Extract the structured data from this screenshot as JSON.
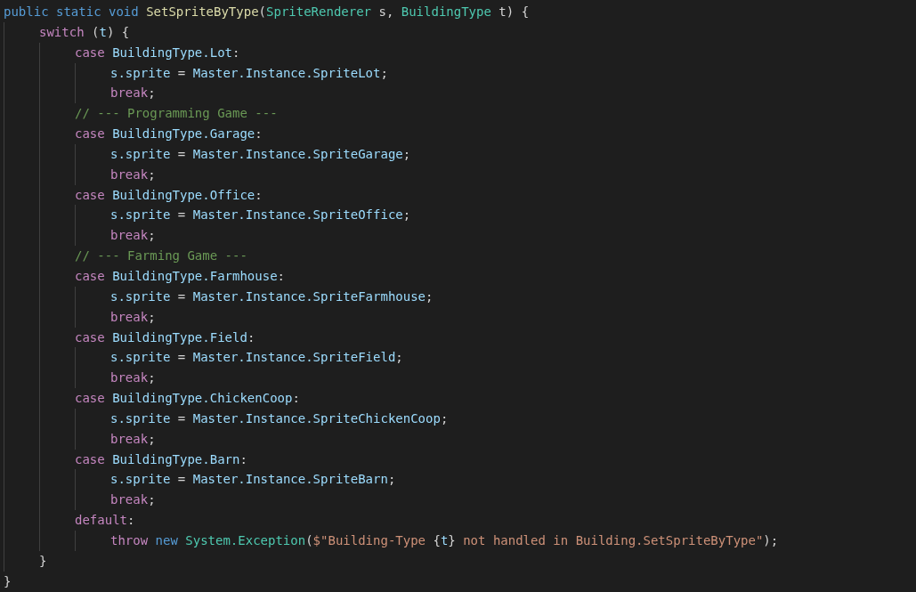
{
  "code_lines": [
    {
      "tokens": [
        {
          "kind": "kw",
          "text": "public static void "
        },
        {
          "kind": "fn",
          "text": "SetSpriteByType"
        },
        {
          "kind": "p",
          "text": "("
        },
        {
          "kind": "ty",
          "text": "SpriteRenderer"
        },
        {
          "kind": "p",
          "text": " s, "
        },
        {
          "kind": "ty",
          "text": "BuildingType"
        },
        {
          "kind": "p",
          "text": " t) {"
        }
      ],
      "children": [
        {
          "tokens": [
            {
              "kind": "ctl",
              "text": "switch"
            },
            {
              "kind": "p",
              "text": " ("
            },
            {
              "kind": "var",
              "text": "t"
            },
            {
              "kind": "p",
              "text": ") {"
            }
          ],
          "children": [
            {
              "tokens": [
                {
                  "kind": "ctl",
                  "text": "case "
                },
                {
                  "kind": "var",
                  "text": "BuildingType.Lot"
                },
                {
                  "kind": "p",
                  "text": ":"
                }
              ],
              "children": [
                {
                  "tokens": [
                    {
                      "kind": "var",
                      "text": "s.sprite"
                    },
                    {
                      "kind": "p",
                      "text": " = "
                    },
                    {
                      "kind": "var",
                      "text": "Master.Instance.SpriteLot"
                    },
                    {
                      "kind": "p",
                      "text": ";"
                    }
                  ]
                },
                {
                  "tokens": [
                    {
                      "kind": "ctl",
                      "text": "break"
                    },
                    {
                      "kind": "p",
                      "text": ";"
                    }
                  ]
                }
              ]
            },
            {
              "tokens": [
                {
                  "kind": "cm",
                  "text": "// --- Programming Game ---"
                }
              ]
            },
            {
              "tokens": [
                {
                  "kind": "ctl",
                  "text": "case "
                },
                {
                  "kind": "var",
                  "text": "BuildingType.Garage"
                },
                {
                  "kind": "p",
                  "text": ":"
                }
              ],
              "children": [
                {
                  "tokens": [
                    {
                      "kind": "var",
                      "text": "s.sprite"
                    },
                    {
                      "kind": "p",
                      "text": " = "
                    },
                    {
                      "kind": "var",
                      "text": "Master.Instance.SpriteGarage"
                    },
                    {
                      "kind": "p",
                      "text": ";"
                    }
                  ]
                },
                {
                  "tokens": [
                    {
                      "kind": "ctl",
                      "text": "break"
                    },
                    {
                      "kind": "p",
                      "text": ";"
                    }
                  ]
                }
              ]
            },
            {
              "tokens": [
                {
                  "kind": "ctl",
                  "text": "case "
                },
                {
                  "kind": "var",
                  "text": "BuildingType.Office"
                },
                {
                  "kind": "p",
                  "text": ":"
                }
              ],
              "children": [
                {
                  "tokens": [
                    {
                      "kind": "var",
                      "text": "s.sprite"
                    },
                    {
                      "kind": "p",
                      "text": " = "
                    },
                    {
                      "kind": "var",
                      "text": "Master.Instance.SpriteOffice"
                    },
                    {
                      "kind": "p",
                      "text": ";"
                    }
                  ]
                },
                {
                  "tokens": [
                    {
                      "kind": "ctl",
                      "text": "break"
                    },
                    {
                      "kind": "p",
                      "text": ";"
                    }
                  ]
                }
              ]
            },
            {
              "tokens": [
                {
                  "kind": "cm",
                  "text": "// --- Farming Game ---"
                }
              ]
            },
            {
              "tokens": [
                {
                  "kind": "ctl",
                  "text": "case "
                },
                {
                  "kind": "var",
                  "text": "BuildingType.Farmhouse"
                },
                {
                  "kind": "p",
                  "text": ":"
                }
              ],
              "children": [
                {
                  "tokens": [
                    {
                      "kind": "var",
                      "text": "s.sprite"
                    },
                    {
                      "kind": "p",
                      "text": " = "
                    },
                    {
                      "kind": "var",
                      "text": "Master.Instance.SpriteFarmhouse"
                    },
                    {
                      "kind": "p",
                      "text": ";"
                    }
                  ]
                },
                {
                  "tokens": [
                    {
                      "kind": "ctl",
                      "text": "break"
                    },
                    {
                      "kind": "p",
                      "text": ";"
                    }
                  ]
                }
              ]
            },
            {
              "tokens": [
                {
                  "kind": "ctl",
                  "text": "case "
                },
                {
                  "kind": "var",
                  "text": "BuildingType.Field"
                },
                {
                  "kind": "p",
                  "text": ":"
                }
              ],
              "children": [
                {
                  "tokens": [
                    {
                      "kind": "var",
                      "text": "s.sprite"
                    },
                    {
                      "kind": "p",
                      "text": " = "
                    },
                    {
                      "kind": "var",
                      "text": "Master.Instance.SpriteField"
                    },
                    {
                      "kind": "p",
                      "text": ";"
                    }
                  ]
                },
                {
                  "tokens": [
                    {
                      "kind": "ctl",
                      "text": "break"
                    },
                    {
                      "kind": "p",
                      "text": ";"
                    }
                  ]
                }
              ]
            },
            {
              "tokens": [
                {
                  "kind": "ctl",
                  "text": "case "
                },
                {
                  "kind": "var",
                  "text": "BuildingType.ChickenCoop"
                },
                {
                  "kind": "p",
                  "text": ":"
                }
              ],
              "children": [
                {
                  "tokens": [
                    {
                      "kind": "var",
                      "text": "s.sprite"
                    },
                    {
                      "kind": "p",
                      "text": " = "
                    },
                    {
                      "kind": "var",
                      "text": "Master.Instance.SpriteChickenCoop"
                    },
                    {
                      "kind": "p",
                      "text": ";"
                    }
                  ]
                },
                {
                  "tokens": [
                    {
                      "kind": "ctl",
                      "text": "break"
                    },
                    {
                      "kind": "p",
                      "text": ";"
                    }
                  ]
                }
              ]
            },
            {
              "tokens": [
                {
                  "kind": "ctl",
                  "text": "case "
                },
                {
                  "kind": "var",
                  "text": "BuildingType.Barn"
                },
                {
                  "kind": "p",
                  "text": ":"
                }
              ],
              "children": [
                {
                  "tokens": [
                    {
                      "kind": "var",
                      "text": "s.sprite"
                    },
                    {
                      "kind": "p",
                      "text": " = "
                    },
                    {
                      "kind": "var",
                      "text": "Master.Instance.SpriteBarn"
                    },
                    {
                      "kind": "p",
                      "text": ";"
                    }
                  ]
                },
                {
                  "tokens": [
                    {
                      "kind": "ctl",
                      "text": "break"
                    },
                    {
                      "kind": "p",
                      "text": ";"
                    }
                  ]
                }
              ]
            },
            {
              "tokens": [
                {
                  "kind": "ctl",
                  "text": "default"
                },
                {
                  "kind": "p",
                  "text": ":"
                }
              ],
              "children": [
                {
                  "tokens": [
                    {
                      "kind": "ctl",
                      "text": "throw "
                    },
                    {
                      "kind": "kw",
                      "text": "new "
                    },
                    {
                      "kind": "ty",
                      "text": "System.Exception"
                    },
                    {
                      "kind": "p",
                      "text": "("
                    },
                    {
                      "kind": "str",
                      "text": "$\"Building-Type "
                    },
                    {
                      "kind": "p",
                      "text": "{"
                    },
                    {
                      "kind": "var",
                      "text": "t"
                    },
                    {
                      "kind": "p",
                      "text": "}"
                    },
                    {
                      "kind": "str",
                      "text": " not handled in Building.SetSpriteByType\""
                    },
                    {
                      "kind": "p",
                      "text": ");"
                    }
                  ]
                }
              ]
            }
          ]
        },
        {
          "tokens": [
            {
              "kind": "p",
              "text": "}"
            }
          ]
        }
      ]
    },
    {
      "tokens": [
        {
          "kind": "p",
          "text": "}"
        }
      ]
    }
  ]
}
